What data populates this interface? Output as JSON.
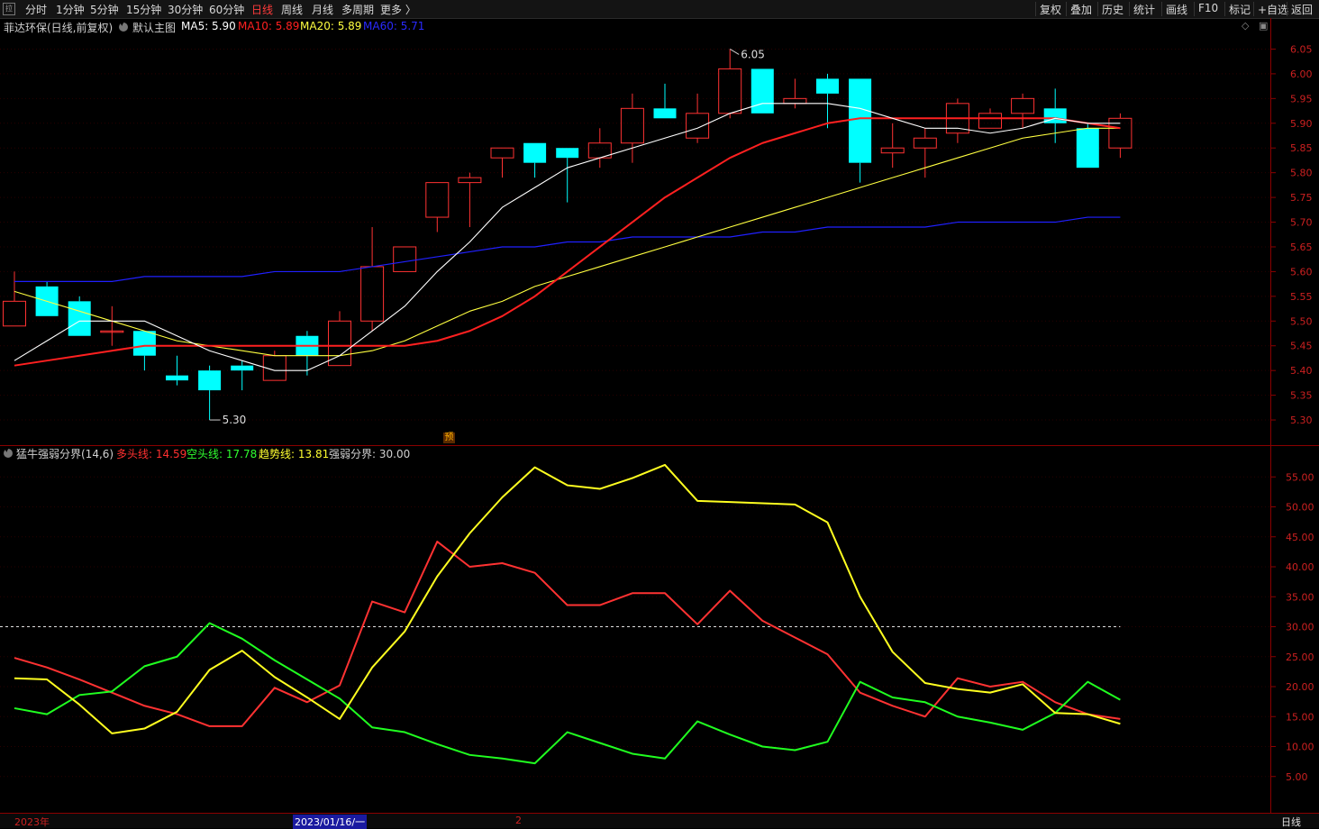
{
  "toolbar": {
    "left": [
      "分时",
      "1分钟",
      "5分钟",
      "15分钟",
      "30分钟",
      "60分钟",
      "日线",
      "周线",
      "月线",
      "多周期",
      "更多 〉"
    ],
    "active": "日线",
    "right": [
      "复权",
      "叠加",
      "历史",
      "统计",
      "画线",
      "F10",
      "标记",
      "+自选",
      "返回"
    ],
    "corner_icon": "拉"
  },
  "main_legend": {
    "stock": "菲达环保(日线,前复权)",
    "template": "默认主图",
    "ma5": "MA5: 5.90",
    "ma10": "MA10: 5.89",
    "ma20": "MA20: 5.89",
    "ma60": "MA60: 5.71",
    "high_marker": "6.05",
    "low_marker": "5.30",
    "pre_tag": "预"
  },
  "sub_legend": {
    "name": "猛牛强弱分界(14,6)",
    "bull": "多头线: 14.59",
    "bear": "空头线: 17.78",
    "trend": "趋势线: 13.81",
    "boundary": "强弱分界: 30.00"
  },
  "bottom": {
    "year": "2023年",
    "date": "2023/01/16/一",
    "mark2": "2",
    "period": "日线"
  },
  "colors": {
    "up": "#ff3232",
    "down": "#00ffff",
    "ma5": "#ffffff",
    "ma10": "#ff2020",
    "ma20": "#ffff40",
    "ma60": "#2020ff",
    "bear": "#20ff20",
    "trend": "#ffff20"
  },
  "chart_data": [
    {
      "type": "candlestick",
      "ylim": [
        5.26,
        6.08
      ],
      "y_ticks": [
        "6.05",
        "6.00",
        "5.95",
        "5.90",
        "5.85",
        "5.80",
        "5.75",
        "5.70",
        "5.65",
        "5.60",
        "5.55",
        "5.50",
        "5.45",
        "5.40",
        "5.35",
        "5.30"
      ],
      "candles": [
        {
          "o": 5.49,
          "h": 5.6,
          "l": 5.49,
          "c": 5.54
        },
        {
          "o": 5.57,
          "h": 5.58,
          "l": 5.51,
          "c": 5.51
        },
        {
          "o": 5.54,
          "h": 5.55,
          "l": 5.47,
          "c": 5.47
        },
        {
          "o": 5.48,
          "h": 5.53,
          "l": 5.45,
          "c": 5.48
        },
        {
          "o": 5.48,
          "h": 5.48,
          "l": 5.4,
          "c": 5.43
        },
        {
          "o": 5.39,
          "h": 5.43,
          "l": 5.37,
          "c": 5.38
        },
        {
          "o": 5.4,
          "h": 5.41,
          "l": 5.3,
          "c": 5.36
        },
        {
          "o": 5.41,
          "h": 5.42,
          "l": 5.36,
          "c": 5.4
        },
        {
          "o": 5.38,
          "h": 5.44,
          "l": 5.38,
          "c": 5.43
        },
        {
          "o": 5.47,
          "h": 5.48,
          "l": 5.39,
          "c": 5.43
        },
        {
          "o": 5.41,
          "h": 5.52,
          "l": 5.41,
          "c": 5.5
        },
        {
          "o": 5.5,
          "h": 5.69,
          "l": 5.48,
          "c": 5.61
        },
        {
          "o": 5.6,
          "h": 5.65,
          "l": 5.6,
          "c": 5.65
        },
        {
          "o": 5.71,
          "h": 5.78,
          "l": 5.68,
          "c": 5.78
        },
        {
          "o": 5.78,
          "h": 5.8,
          "l": 5.69,
          "c": 5.79
        },
        {
          "o": 5.83,
          "h": 5.85,
          "l": 5.79,
          "c": 5.85
        },
        {
          "o": 5.86,
          "h": 5.86,
          "l": 5.79,
          "c": 5.82
        },
        {
          "o": 5.85,
          "h": 5.85,
          "l": 5.74,
          "c": 5.83
        },
        {
          "o": 5.83,
          "h": 5.89,
          "l": 5.81,
          "c": 5.86
        },
        {
          "o": 5.86,
          "h": 5.96,
          "l": 5.82,
          "c": 5.93
        },
        {
          "o": 5.93,
          "h": 5.98,
          "l": 5.91,
          "c": 5.91
        },
        {
          "o": 5.87,
          "h": 5.96,
          "l": 5.86,
          "c": 5.92
        },
        {
          "o": 5.92,
          "h": 6.05,
          "l": 5.91,
          "c": 6.01
        },
        {
          "o": 6.01,
          "h": 6.01,
          "l": 5.92,
          "c": 5.92
        },
        {
          "o": 5.94,
          "h": 5.99,
          "l": 5.93,
          "c": 5.95
        },
        {
          "o": 5.99,
          "h": 6.0,
          "l": 5.89,
          "c": 5.96
        },
        {
          "o": 5.99,
          "h": 5.99,
          "l": 5.78,
          "c": 5.82
        },
        {
          "o": 5.84,
          "h": 5.9,
          "l": 5.81,
          "c": 5.85
        },
        {
          "o": 5.85,
          "h": 5.89,
          "l": 5.79,
          "c": 5.87
        },
        {
          "o": 5.88,
          "h": 5.95,
          "l": 5.86,
          "c": 5.94
        },
        {
          "o": 5.89,
          "h": 5.93,
          "l": 5.89,
          "c": 5.92
        },
        {
          "o": 5.92,
          "h": 5.96,
          "l": 5.89,
          "c": 5.95
        },
        {
          "o": 5.93,
          "h": 5.97,
          "l": 5.86,
          "c": 5.9
        },
        {
          "o": 5.89,
          "h": 5.9,
          "l": 5.81,
          "c": 5.81
        },
        {
          "o": 5.85,
          "h": 5.92,
          "l": 5.83,
          "c": 5.91
        }
      ],
      "ma5": [
        5.42,
        5.46,
        5.5,
        5.5,
        5.5,
        5.47,
        5.44,
        5.42,
        5.4,
        5.4,
        5.43,
        5.48,
        5.53,
        5.6,
        5.66,
        5.73,
        5.77,
        5.81,
        5.83,
        5.85,
        5.87,
        5.89,
        5.92,
        5.94,
        5.94,
        5.94,
        5.93,
        5.91,
        5.89,
        5.89,
        5.88,
        5.89,
        5.91,
        5.9,
        5.9
      ],
      "ma10": [
        5.41,
        5.42,
        5.43,
        5.44,
        5.45,
        5.45,
        5.45,
        5.45,
        5.45,
        5.45,
        5.45,
        5.45,
        5.45,
        5.46,
        5.48,
        5.51,
        5.55,
        5.6,
        5.65,
        5.7,
        5.75,
        5.79,
        5.83,
        5.86,
        5.88,
        5.9,
        5.91,
        5.91,
        5.91,
        5.91,
        5.91,
        5.91,
        5.91,
        5.9,
        5.89
      ],
      "ma20": [
        5.56,
        5.54,
        5.52,
        5.5,
        5.48,
        5.46,
        5.45,
        5.44,
        5.43,
        5.43,
        5.43,
        5.44,
        5.46,
        5.49,
        5.52,
        5.54,
        5.57,
        5.59,
        5.61,
        5.63,
        5.65,
        5.67,
        5.69,
        5.71,
        5.73,
        5.75,
        5.77,
        5.79,
        5.81,
        5.83,
        5.85,
        5.87,
        5.88,
        5.89,
        5.89
      ],
      "ma60": [
        5.58,
        5.58,
        5.58,
        5.58,
        5.59,
        5.59,
        5.59,
        5.59,
        5.6,
        5.6,
        5.6,
        5.61,
        5.62,
        5.63,
        5.64,
        5.65,
        5.65,
        5.66,
        5.66,
        5.67,
        5.67,
        5.67,
        5.67,
        5.68,
        5.68,
        5.69,
        5.69,
        5.69,
        5.69,
        5.7,
        5.7,
        5.7,
        5.7,
        5.71,
        5.71
      ]
    },
    {
      "type": "line",
      "ylim": [
        0,
        60
      ],
      "y_ticks": [
        "55.00",
        "50.00",
        "45.00",
        "40.00",
        "35.00",
        "30.00",
        "25.00",
        "20.00",
        "15.00",
        "10.00",
        "5.00"
      ],
      "boundary": 30,
      "series": [
        {
          "name": "多头线",
          "values": [
            24.8,
            23.2,
            21.2,
            19.0,
            16.8,
            15.4,
            13.4,
            13.4,
            19.8,
            17.4,
            20.2,
            34.2,
            32.4,
            44.2,
            40.0,
            40.6,
            39.0,
            33.6,
            33.6,
            35.6,
            35.6,
            30.4,
            36.0,
            31.0,
            28.2,
            25.4,
            19.0,
            16.8,
            15.0,
            21.4,
            20.0,
            20.8,
            17.4,
            15.4,
            14.6
          ]
        },
        {
          "name": "空头线",
          "values": [
            16.4,
            15.4,
            18.6,
            19.2,
            23.4,
            25.0,
            30.6,
            28.0,
            24.4,
            21.2,
            18.0,
            13.2,
            12.4,
            10.4,
            8.6,
            8.0,
            7.2,
            12.4,
            10.6,
            8.8,
            8.0,
            14.2,
            12.0,
            10.0,
            9.4,
            10.8,
            20.8,
            18.2,
            17.4,
            15.0,
            14.0,
            12.8,
            15.6,
            20.8,
            17.8
          ]
        },
        {
          "name": "趋势线",
          "values": [
            21.4,
            21.2,
            17.0,
            12.2,
            13.0,
            15.8,
            22.8,
            26.0,
            21.6,
            18.2,
            14.6,
            23.2,
            29.2,
            38.4,
            45.6,
            51.6,
            56.6,
            53.6,
            53.0,
            54.8,
            57.0,
            51.0,
            50.8,
            50.6,
            50.4,
            47.4,
            35.0,
            25.8,
            20.6,
            19.6,
            19.0,
            20.4,
            15.6,
            15.4,
            13.8
          ]
        }
      ]
    }
  ]
}
